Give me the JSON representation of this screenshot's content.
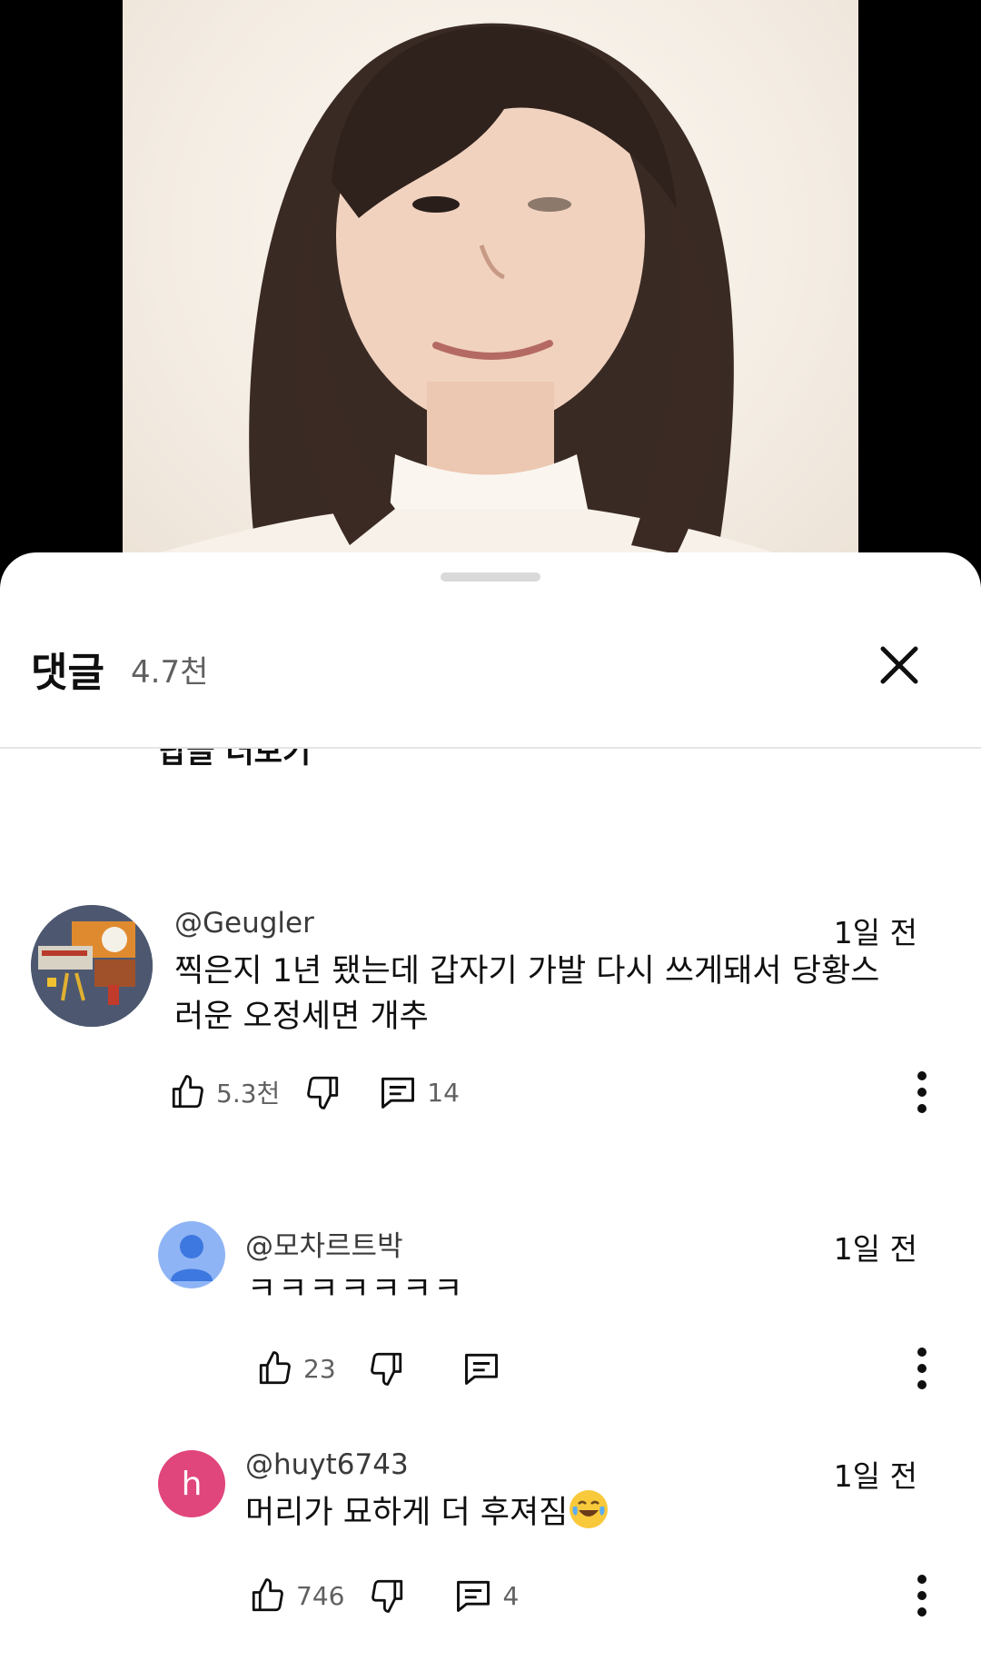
{
  "sheet": {
    "title": "댓글",
    "count": "4.7천",
    "partial_link": "답글 더보기"
  },
  "comments": [
    {
      "author": "@Geugler",
      "time": "1일 전",
      "text_line1": "찍은지 1년 됐는데 갑자기 가발 다시 쓰게돼서 당황스",
      "text_line2": "러운 오정세면 개추",
      "likes": "5.3천",
      "replies": "14"
    },
    {
      "author": "@모차르트박",
      "time": "1일 전",
      "text": "ㅋㅋㅋㅋㅋㅋㅋ",
      "likes": "23"
    },
    {
      "author": "@huyt6743",
      "avatar_letter": "h",
      "time": "1일 전",
      "text": "머리가 묘하게 더 후져짐",
      "likes": "746",
      "replies": "4"
    }
  ],
  "colors": {
    "avatar_h": "#e0457b",
    "avatar_default": "#8fb4f5"
  }
}
